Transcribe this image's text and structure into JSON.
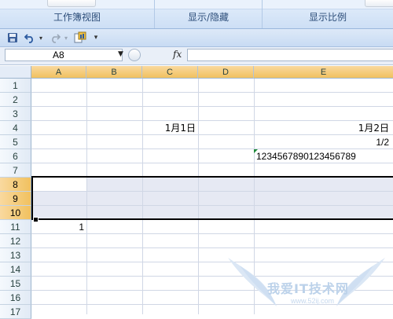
{
  "ribbon": {
    "groups": [
      {
        "label": "工作簿视图"
      },
      {
        "label": "显示/隐藏"
      },
      {
        "label": "显示比例"
      }
    ]
  },
  "qat": {
    "save": "save-icon",
    "undo": "undo-icon",
    "redo": "redo-icon",
    "custom": "custom-icon",
    "more": "▾"
  },
  "formula_bar": {
    "name_box": "A8",
    "fx_label": "fx",
    "formula": ""
  },
  "sheet": {
    "columns": [
      "A",
      "B",
      "C",
      "D",
      "E"
    ],
    "rows": [
      "1",
      "2",
      "3",
      "4",
      "5",
      "6",
      "7",
      "8",
      "9",
      "10",
      "11",
      "12",
      "13",
      "14",
      "15",
      "16",
      "17"
    ],
    "selected_rows": [
      "8",
      "9",
      "10"
    ],
    "cells": {
      "C4": "1月1日",
      "E4": "1月2日",
      "E5": "1/2",
      "E6": "1234567890123456789",
      "A11": "1"
    }
  },
  "watermark": {
    "text": "我爱IT技术网",
    "url": "www.52ij.com"
  },
  "colors": {
    "selection_header": "#f1c15f",
    "grid": "#d0d7e5",
    "selection_fill": "#e6e9f3",
    "error_indicator": "#1f8a3b"
  }
}
